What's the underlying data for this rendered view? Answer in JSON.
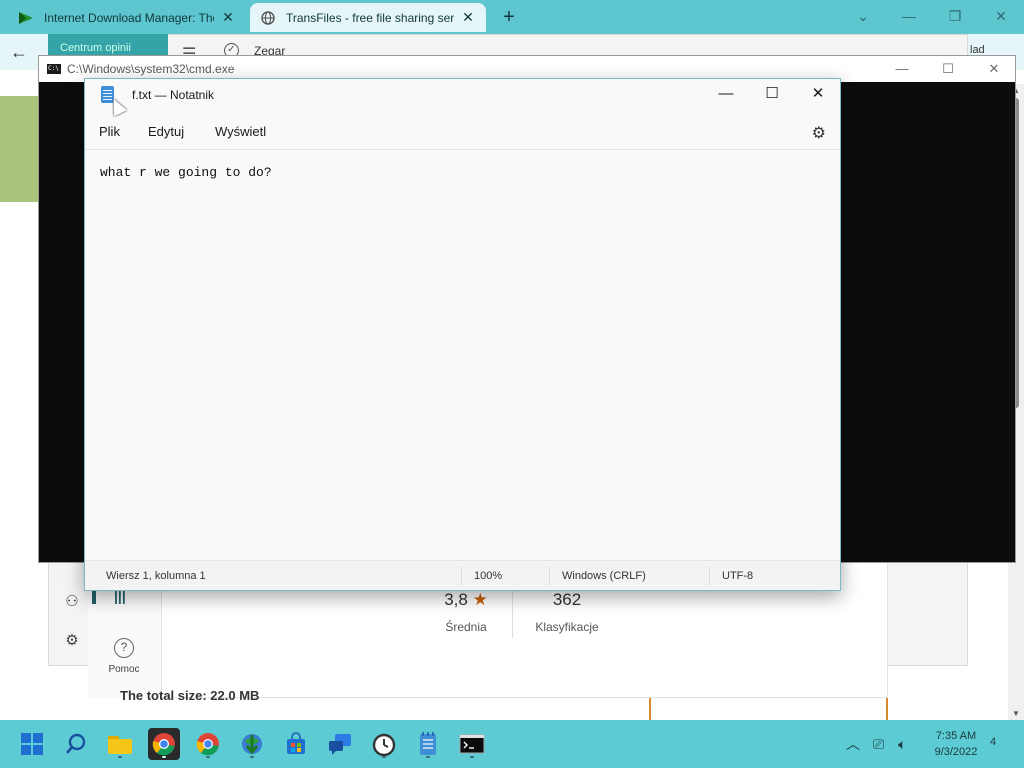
{
  "browser": {
    "tabs": [
      {
        "title": "Internet Download Manager: The",
        "icon": "idm-icon"
      },
      {
        "title": "TransFiles - free file sharing service",
        "icon": "globe-icon"
      }
    ],
    "new_tab": "+",
    "teal_tab": "Centrum opinii",
    "clock_window": "Zegar",
    "clock_window_right": "lad"
  },
  "cmd": {
    "title": "C:\\Windows\\system32\\cmd.exe"
  },
  "notepad": {
    "title": "f.txt — Notatnik",
    "menu": [
      "Plik",
      "Edytuj",
      "Wyświetl"
    ],
    "content": "what r we going to do?",
    "status": {
      "position": "Wiersz 1, kolumna 1",
      "zoom": "100%",
      "line_endings": "Windows (CRLF)",
      "encoding": "UTF-8"
    }
  },
  "background_page": {
    "rating": "3,8",
    "rating_label": "Średnia",
    "count": "362",
    "count_label": "Klasyfikacje",
    "help_label": "Pomoc",
    "total_size": "The total size: 22.0 MB"
  },
  "taskbar": {
    "time": "7:35 AM",
    "date": "9/3/2022",
    "notifications": "4"
  },
  "colors": {
    "accent": "#5ccbd4",
    "tabbar": "#5ec6cf",
    "star": "#c8620a"
  }
}
